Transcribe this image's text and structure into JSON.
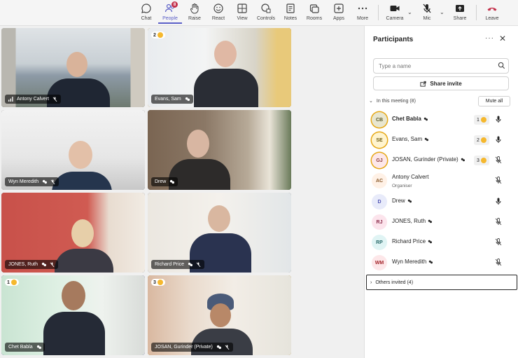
{
  "toolbar": {
    "items": [
      {
        "label": "Chat",
        "icon": "chat-icon"
      },
      {
        "label": "People",
        "icon": "people-icon",
        "badge": "8"
      },
      {
        "label": "Raise",
        "icon": "raise-hand-icon"
      },
      {
        "label": "React",
        "icon": "react-icon"
      },
      {
        "label": "View",
        "icon": "view-icon"
      },
      {
        "label": "Controls",
        "icon": "controls-icon"
      },
      {
        "label": "Notes",
        "icon": "notes-icon"
      },
      {
        "label": "Rooms",
        "icon": "rooms-icon"
      },
      {
        "label": "Apps",
        "icon": "apps-icon"
      },
      {
        "label": "More",
        "icon": "more-icon"
      },
      {
        "label": "Camera",
        "icon": "camera-icon"
      },
      {
        "label": "Mic",
        "icon": "mic-off-icon"
      },
      {
        "label": "Share",
        "icon": "share-icon"
      },
      {
        "label": "Leave",
        "icon": "leave-icon"
      }
    ],
    "colors": {
      "accent": "#5b5fc7",
      "leave": "#c4314b"
    }
  },
  "tiles": [
    {
      "name": "Antony Calvert",
      "hand": ""
    },
    {
      "name": "Evans, Sam",
      "hand": "2"
    },
    {
      "name": "Wyn Meredith",
      "hand": ""
    },
    {
      "name": "Drew",
      "hand": ""
    },
    {
      "name": "JONES, Ruth",
      "hand": ""
    },
    {
      "name": "Richard Price",
      "hand": ""
    },
    {
      "name": "Chet Babla",
      "hand": "1"
    },
    {
      "name": "JOSAN, Gurinder (Private)",
      "hand": "3"
    }
  ],
  "panel": {
    "title": "Participants",
    "more": "···",
    "close": "✕",
    "search_placeholder": "Type a name",
    "share_invite": "Share invite",
    "section": "In this meeting (8)",
    "mute_all": "Mute all",
    "participants": [
      {
        "initials": "CB",
        "name": "Chet Babla",
        "hand": "1",
        "avatar_bg": "#e8e6cf",
        "avatar_fg": "#5a5a2a"
      },
      {
        "initials": "SE",
        "name": "Evans, Sam",
        "hand": "2",
        "avatar_bg": "#fff4ce",
        "avatar_fg": "#6b5a10"
      },
      {
        "initials": "GJ",
        "name": "JOSAN, Gurinder (Private)",
        "hand": "3",
        "avatar_bg": "#fde7e9",
        "avatar_fg": "#8a3a3a"
      },
      {
        "initials": "AC",
        "name": "Antony Calvert",
        "sub": "Organiser",
        "avatar_bg": "#fff1e6",
        "avatar_fg": "#8a5a2a"
      },
      {
        "initials": "D",
        "name": "Drew",
        "avatar_bg": "#e8ebfa",
        "avatar_fg": "#4f52b2"
      },
      {
        "initials": "RJ",
        "name": "JONES, Ruth",
        "avatar_bg": "#fce4ec",
        "avatar_fg": "#8a2a4a"
      },
      {
        "initials": "RP",
        "name": "Richard Price",
        "avatar_bg": "#e0f4f4",
        "avatar_fg": "#2a6a6a"
      },
      {
        "initials": "WM",
        "name": "Wyn Meredith",
        "avatar_bg": "#fde7e9",
        "avatar_fg": "#a4262c"
      }
    ],
    "others": "Others invited (4)"
  }
}
